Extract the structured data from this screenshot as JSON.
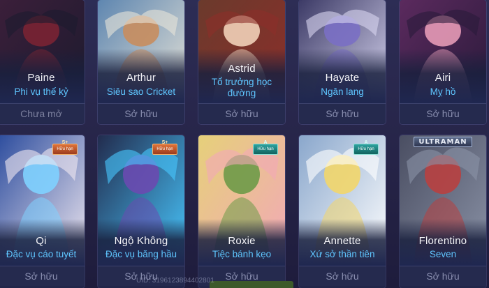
{
  "rows": [
    [
      {
        "hero": "Paine",
        "skin": "Phi vụ thế kỷ",
        "status": "Chưa mở",
        "owned": false,
        "palette": [
          "#3b1f3a",
          "#7a2433",
          "#1c1a2e"
        ]
      },
      {
        "hero": "Arthur",
        "skin": "Siêu sao Cricket",
        "status": "Sở hữu",
        "owned": true,
        "palette": [
          "#5e86b0",
          "#c88d5e",
          "#e8e4d8"
        ]
      },
      {
        "hero": "Astrid",
        "skin": "Tổ trưởng học đường",
        "status": "Sở hữu",
        "owned": true,
        "palette": [
          "#6b3a2c",
          "#f1d0b8",
          "#8c2e2a"
        ]
      },
      {
        "hero": "Hayate",
        "skin": "Ngân lang",
        "status": "Sở hữu",
        "owned": true,
        "palette": [
          "#3c3a66",
          "#7a6fc4",
          "#d8d6f0"
        ]
      },
      {
        "hero": "Airi",
        "skin": "Mỵ hồ",
        "status": "Sở hữu",
        "owned": true,
        "palette": [
          "#5b2a5e",
          "#e59ab6",
          "#2a1a3a"
        ]
      }
    ],
    [
      {
        "hero": "Qi",
        "skin": "Đặc vụ cáo tuyết",
        "status": "Sở hữu",
        "owned": true,
        "palette": [
          "#2d4d9e",
          "#7fd2ff",
          "#f0e8f0"
        ],
        "badge": {
          "tier": "S+",
          "text": "Hữu hạn",
          "color": "orange"
        }
      },
      {
        "hero": "Ngộ Không",
        "skin": "Đặc vụ băng hầu",
        "status": "Sở hữu",
        "owned": true,
        "palette": [
          "#222c4e",
          "#6a4ab0",
          "#48c8ff"
        ],
        "badge": {
          "tier": "S+",
          "text": "Hữu hạn",
          "color": "orange"
        }
      },
      {
        "hero": "Roxie",
        "skin": "Tiệc bánh kẹo",
        "status": "Sở hữu",
        "owned": true,
        "palette": [
          "#e6d07a",
          "#6e9a48",
          "#f2a8b8"
        ],
        "badge": {
          "tier": "A",
          "text": "Hữu hạn",
          "color": "teal"
        }
      },
      {
        "hero": "Annette",
        "skin": "Xứ sở thần tiên",
        "status": "Sở hữu",
        "owned": true,
        "palette": [
          "#8aa7cc",
          "#f2d66a",
          "#ffffff"
        ],
        "badge": {
          "tier": "A",
          "text": "Hữu hạn",
          "color": "teal"
        }
      },
      {
        "hero": "Florentino",
        "skin": "Seven",
        "status": "Sở hữu",
        "owned": true,
        "palette": [
          "#4a4e62",
          "#b84040",
          "#8a92a6"
        ],
        "banner": "ULTRAMAN"
      }
    ]
  ],
  "footer": {
    "uid": "UID: 3196123894402801"
  },
  "colors": {
    "skin_text": "#5fc6ff",
    "status_text": "#8a8fb0",
    "background": "#262448"
  }
}
